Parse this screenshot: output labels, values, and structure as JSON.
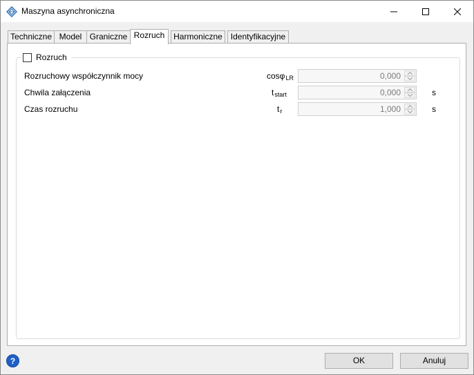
{
  "window": {
    "title": "Maszyna asynchroniczna"
  },
  "tabs": [
    {
      "label": "Techniczne"
    },
    {
      "label": "Model"
    },
    {
      "label": "Graniczne"
    },
    {
      "label": "Rozruch",
      "active": true
    },
    {
      "label": "Harmoniczne"
    },
    {
      "label": "Identyfikacyjne"
    }
  ],
  "group": {
    "checkbox_label": "Rozruch",
    "checked": false
  },
  "fields": [
    {
      "label": "Rozruchowy współczynnik mocy",
      "symbol": "cosφ",
      "subscript": "LR",
      "value": "0,000",
      "unit": ""
    },
    {
      "label": "Chwila załączenia",
      "symbol": "t",
      "subscript": "start",
      "value": "0,000",
      "unit": "s"
    },
    {
      "label": "Czas rozruchu",
      "symbol": "t",
      "subscript": "r",
      "value": "1,000",
      "unit": "s"
    }
  ],
  "buttons": {
    "ok": "OK",
    "cancel": "Anuluj",
    "help": "?"
  },
  "icons": {
    "app": "diamond-network-icon",
    "minimize": "minimize-icon",
    "maximize": "maximize-icon",
    "close": "close-icon",
    "help": "help-icon",
    "spin_up": "chevron-up-icon",
    "spin_down": "chevron-down-icon"
  },
  "colors": {
    "accent": "#1f5fc8",
    "tab_active": "#ffffff",
    "disabled_text": "#7a7a7a"
  }
}
